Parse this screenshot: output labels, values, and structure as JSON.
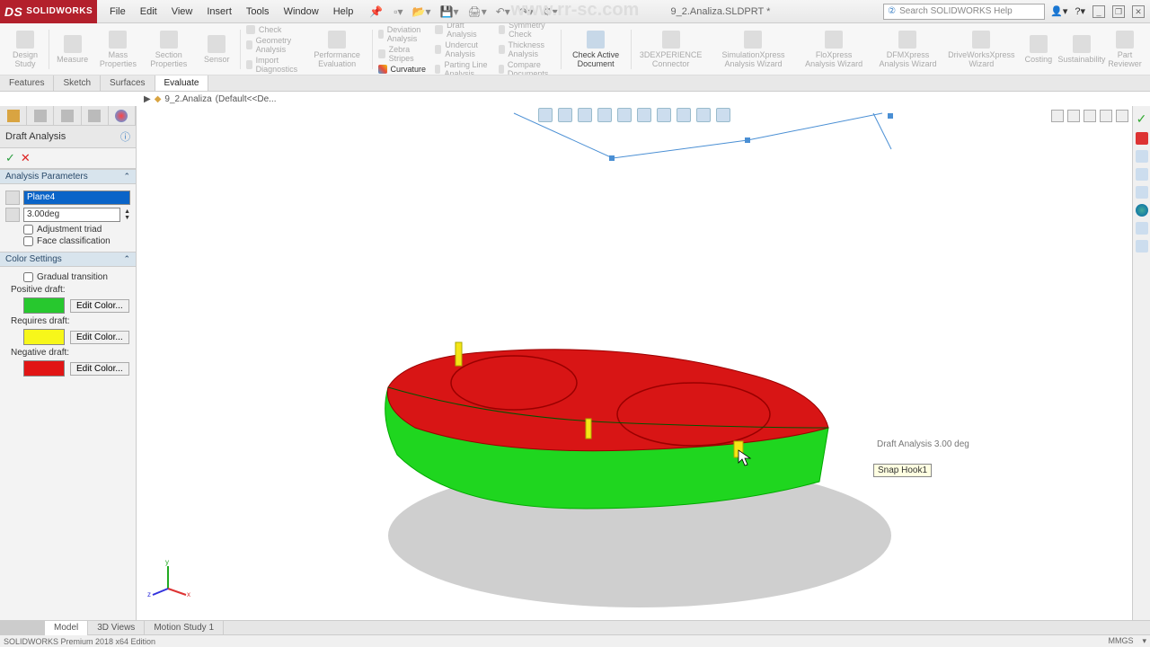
{
  "app": {
    "name": "SOLIDWORKS",
    "doc_title": "9_2.Analiza.SLDPRT *"
  },
  "menu": [
    "File",
    "Edit",
    "View",
    "Insert",
    "Tools",
    "Window",
    "Help"
  ],
  "search_placeholder": "Search SOLIDWORKS Help",
  "ribbon": {
    "left_small": [
      "Design Study",
      "Measure",
      "Mass Properties",
      "Section Properties",
      "Sensor"
    ],
    "checks": {
      "check": "Check",
      "geom": "Geometry Analysis",
      "import": "Import Diagnostics"
    },
    "perf": {
      "title": "Performance Evaluation"
    },
    "analysis_col1": [
      "Deviation Analysis",
      "Zebra Stripes",
      "Curvature"
    ],
    "analysis_col2": [
      "Draft Analysis",
      "Undercut Analysis",
      "Parting Line Analysis"
    ],
    "analysis_col3": [
      "Symmetry Check",
      "Thickness Analysis",
      "Compare Documents"
    ],
    "check_active": "Check Active Document",
    "right_small": [
      "3DEXPERIENCE Connector",
      "SimulationXpress Analysis Wizard",
      "FloXpress Analysis Wizard",
      "DFMXpress Analysis Wizard",
      "DriveWorksXpress Wizard",
      "Costing",
      "Sustainability",
      "Part Reviewer"
    ]
  },
  "cmdtabs": [
    "Features",
    "Sketch",
    "Surfaces",
    "Evaluate"
  ],
  "cmdtab_active": "Evaluate",
  "breadcrumb": {
    "part": "9_2.Analiza",
    "config": "(Default<<De..."
  },
  "panel": {
    "title": "Draft Analysis",
    "sec_params": "Analysis Parameters",
    "plane_field": "Plane4",
    "angle_field": "3.00deg",
    "adjust_triad": "Adjustment triad",
    "face_class": "Face classification",
    "sec_colors": "Color Settings",
    "gradual": "Gradual transition",
    "positive": "Positive draft:",
    "requires": "Requires draft:",
    "negative": "Negative draft:",
    "edit_color": "Edit Color...",
    "colors": {
      "positive": "#27c82e",
      "requires": "#f7f71a",
      "negative": "#e11515"
    }
  },
  "viewport": {
    "callout": "Draft Analysis 3.00 deg",
    "tooltip": "Snap Hook1"
  },
  "bottom_tabs": [
    "Model",
    "3D Views",
    "Motion Study 1"
  ],
  "bottom_active": "Model",
  "status": {
    "left": "SOLIDWORKS Premium 2018 x64 Edition",
    "units": "MMGS"
  },
  "url_overlay": "www.rr-sc.com"
}
